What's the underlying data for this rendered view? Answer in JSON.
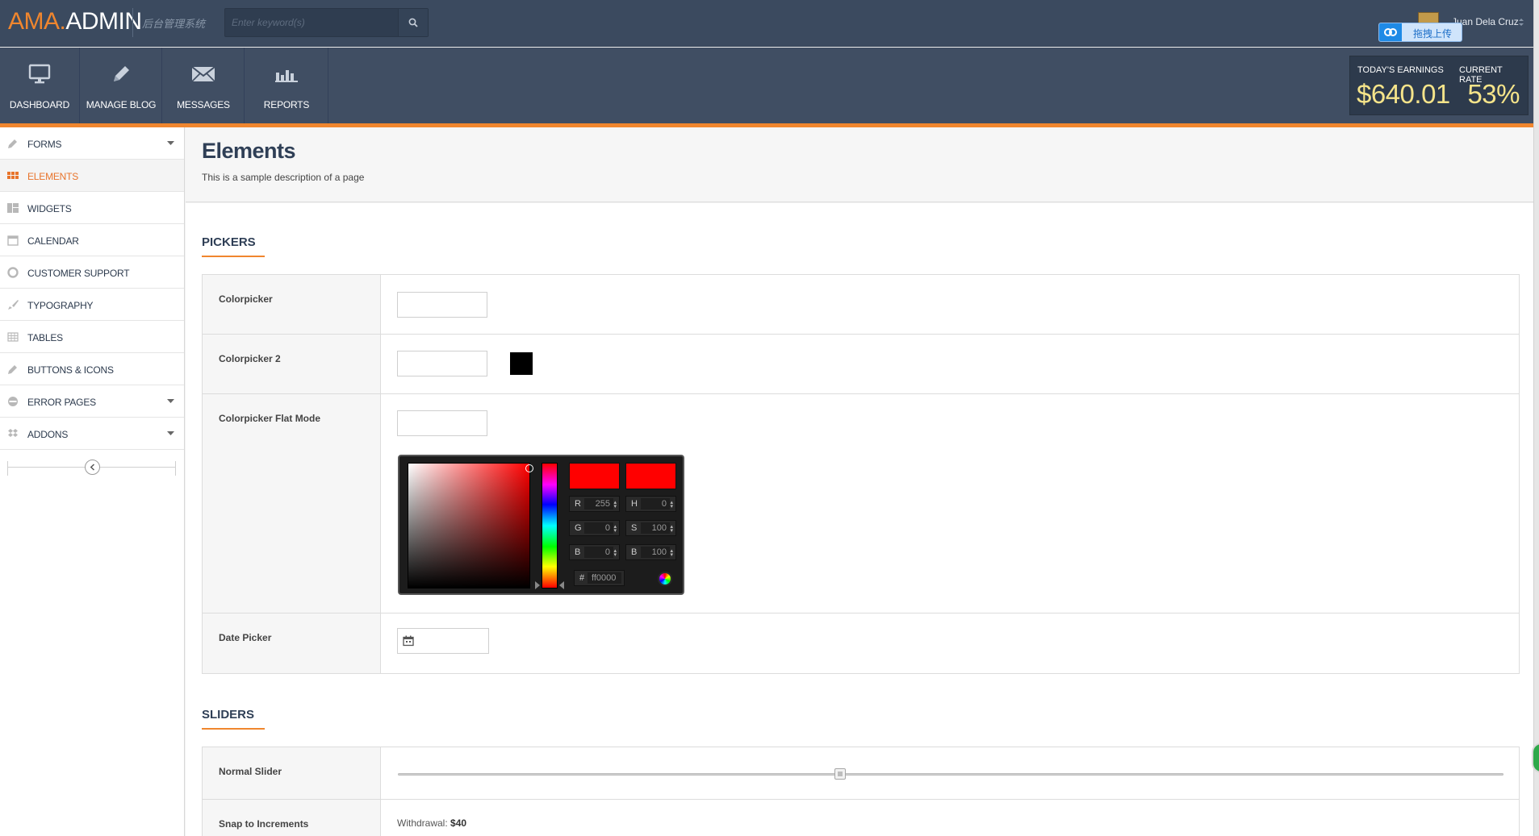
{
  "header": {
    "logo_part1": "AMA.",
    "logo_part2": "ADMIN",
    "logo_subtitle": "后台管理系统",
    "search_placeholder": "Enter keyword(s)",
    "user_name": "Juan Dela Cruz",
    "upload_label": "拖拽上传"
  },
  "nav": {
    "items": [
      {
        "label": "DASHBOARD",
        "icon": "monitor-icon"
      },
      {
        "label": "MANAGE BLOG",
        "icon": "pencil-icon"
      },
      {
        "label": "MESSAGES",
        "icon": "envelope-icon"
      },
      {
        "label": "REPORTS",
        "icon": "bar-chart-icon"
      }
    ],
    "earnings_label": "TODAY'S EARNINGS",
    "earnings_value": "$640.01",
    "rate_label": "CURRENT RATE",
    "rate_value": "53%"
  },
  "sidebar": {
    "items": [
      {
        "label": "FORMS",
        "icon": "pencil-icon",
        "has_caret": true
      },
      {
        "label": "ELEMENTS",
        "icon": "grid-icon",
        "active": true
      },
      {
        "label": "WIDGETS",
        "icon": "widgets-icon"
      },
      {
        "label": "CALENDAR",
        "icon": "calendar-icon"
      },
      {
        "label": "CUSTOMER SUPPORT",
        "icon": "lifebuoy-icon"
      },
      {
        "label": "TYPOGRAPHY",
        "icon": "brush-icon"
      },
      {
        "label": "TABLES",
        "icon": "table-icon"
      },
      {
        "label": "BUTTONS & ICONS",
        "icon": "pencil-icon"
      },
      {
        "label": "ERROR PAGES",
        "icon": "no-entry-icon",
        "has_caret": true
      },
      {
        "label": "ADDONS",
        "icon": "dropbox-icon",
        "has_caret": true
      }
    ]
  },
  "page": {
    "title": "Elements",
    "description": "This is a sample description of a page"
  },
  "pickers": {
    "section_title": "PICKERS",
    "colorpicker_label": "Colorpicker",
    "colorpicker2_label": "Colorpicker 2",
    "colorpicker2_swatch": "#000000",
    "flat_label": "Colorpicker Flat Mode",
    "flat": {
      "r_label": "R",
      "r": "255",
      "g_label": "G",
      "g": "0",
      "b_label": "B",
      "b": "0",
      "h_label": "H",
      "h": "0",
      "s_label": "S",
      "s": "100",
      "v_label": "B",
      "v": "100",
      "hex_label": "#",
      "hex": "ff0000",
      "current_color": "#ff0000"
    },
    "date_label": "Date Picker"
  },
  "sliders": {
    "section_title": "SLIDERS",
    "normal_label": "Normal Slider",
    "normal_value": 0.4,
    "snap_label": "Snap to Increments",
    "withdrawal_label": "Withdrawal:",
    "withdrawal_value": "$40"
  },
  "colors": {
    "accent": "#f0862e",
    "header_bg": "#3b4a5f",
    "nav_bg": "#404e63",
    "earnings_value": "#f5e48a"
  }
}
